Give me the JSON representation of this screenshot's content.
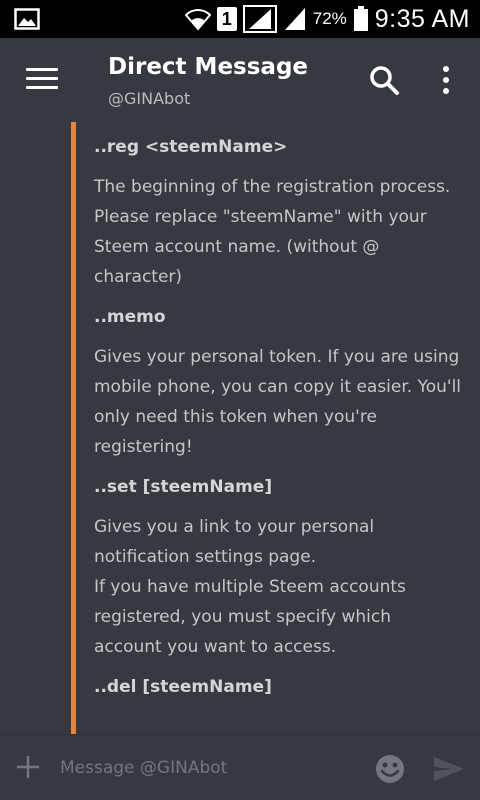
{
  "status_bar": {
    "sim_slot": "1",
    "battery": "72%",
    "time": "9:35 AM"
  },
  "header": {
    "title": "Direct Message",
    "subtitle": "@GINAbot"
  },
  "messages": [
    {
      "command": "..reg <steemName>",
      "description": "The beginning of the registration process.\nPlease replace \"steemName\" with your Steem account name. (without @ character)"
    },
    {
      "command": "..memo",
      "description": "Gives your personal token. If you are using mobile phone, you can copy it easier. You'll only need this token when you're registering!"
    },
    {
      "command": "..set [steemName]",
      "description": "Gives you a link to your personal notification settings page.\nIf you have multiple Steem accounts registered, you must specify which account you want to access."
    },
    {
      "command": "..del [steemName]",
      "description": ""
    }
  ],
  "composer": {
    "placeholder": "Message @GINAbot"
  },
  "colors": {
    "background": "#36393f",
    "embed_accent": "#e8833a",
    "statusbar": "#000000"
  },
  "icons": {
    "gallery": "gallery-icon",
    "wifi": "wifi-icon",
    "signal": "signal-icon",
    "battery": "battery-icon",
    "menu": "hamburger-menu-icon",
    "search": "search-icon",
    "more": "more-vertical-icon",
    "plus": "plus-icon",
    "emoji": "emoji-icon",
    "send": "send-icon"
  }
}
